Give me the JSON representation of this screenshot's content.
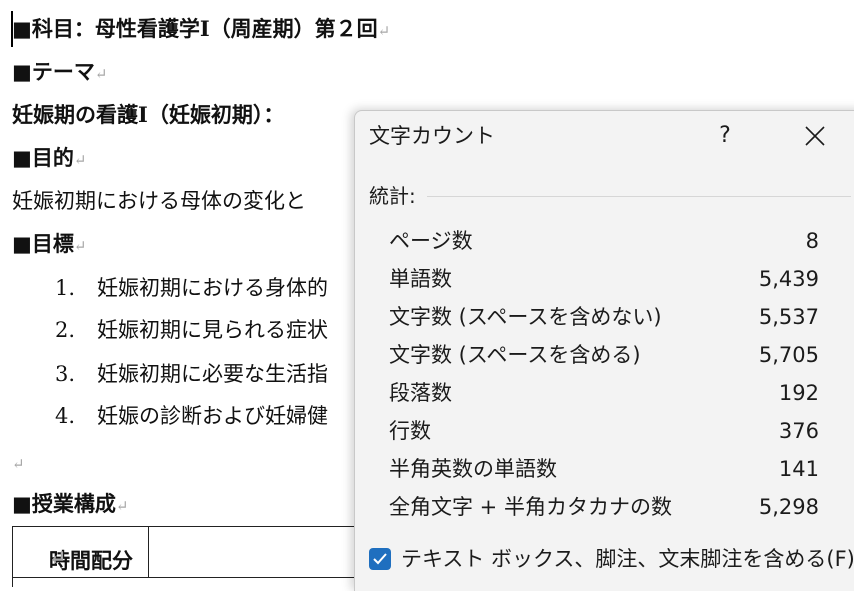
{
  "document": {
    "subject_line": "■科目：母性看護学Ⅰ（周産期）第２回",
    "theme_heading": "■テーマ",
    "theme_text": "妊娠期の看護Ⅰ（妊娠初期）：",
    "purpose_heading": "■目的",
    "purpose_text": "妊娠初期における母体の変化と",
    "goals_heading": "■目標",
    "goals": [
      {
        "num": "1.",
        "text": "妊娠初期における身体的"
      },
      {
        "num": "2.",
        "text": "妊娠初期に見られる症状"
      },
      {
        "num": "3.",
        "text": "妊娠初期に必要な生活指"
      },
      {
        "num": "4.",
        "text": "妊娠の診断および妊婦健"
      }
    ],
    "class_structure_heading": "■授業構成",
    "table_header": "時間配分",
    "paragraph_mark": "↵"
  },
  "dialog": {
    "title": "文字カウント",
    "help_label": "?",
    "section_label": "統計:",
    "stats": [
      {
        "label": "ページ数",
        "value": "8"
      },
      {
        "label": "単語数",
        "value": "5,439"
      },
      {
        "label": "文字数 (スペースを含めない)",
        "value": "5,537"
      },
      {
        "label": "文字数 (スペースを含める)",
        "value": "5,705"
      },
      {
        "label": "段落数",
        "value": "192"
      },
      {
        "label": "行数",
        "value": "376"
      },
      {
        "label": "半角英数の単語数",
        "value": "141"
      },
      {
        "label": "全角文字 + 半角カタカナの数",
        "value": "5,298"
      }
    ],
    "include_textbox_label": "テキスト ボックス、脚注、文末脚注を含める(F)",
    "include_textbox_checked": true,
    "accent_color": "#1f6fbf"
  }
}
